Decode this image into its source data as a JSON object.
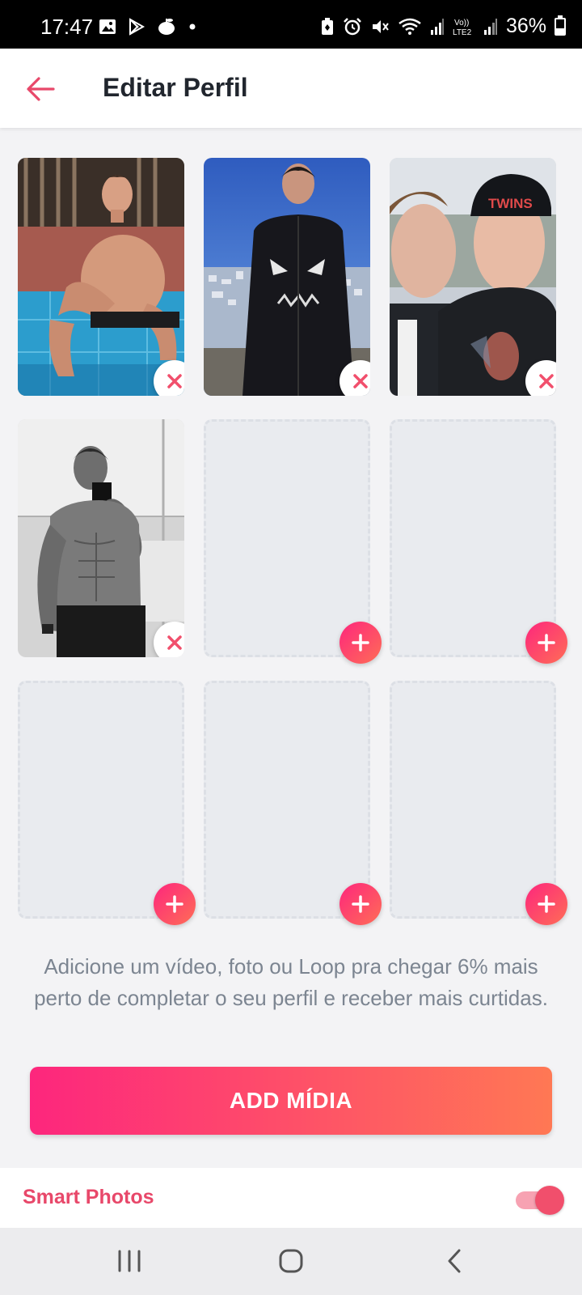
{
  "status_bar": {
    "time": "17:47",
    "battery": "36%",
    "battery_level": 0.36,
    "icons_left": [
      "gallery-icon",
      "play-store-icon",
      "apple-icon",
      "dot-icon"
    ],
    "icons_right": [
      "battery-saver-icon",
      "alarm-icon",
      "mute-icon",
      "wifi-icon",
      "signal-icon",
      "volte-icon",
      "signal-icon"
    ],
    "volte_label": "Vo))\nLTE2"
  },
  "header": {
    "back_icon": "arrow-left-icon",
    "title": "Editar Perfil",
    "accent": "#e8486a"
  },
  "media_grid": {
    "tiles": [
      {
        "state": "photo",
        "action": "remove"
      },
      {
        "state": "photo",
        "action": "remove"
      },
      {
        "state": "photo",
        "action": "remove"
      },
      {
        "state": "photo",
        "action": "remove"
      },
      {
        "state": "empty",
        "action": "add"
      },
      {
        "state": "empty",
        "action": "add"
      },
      {
        "state": "empty",
        "action": "add"
      },
      {
        "state": "empty",
        "action": "add"
      },
      {
        "state": "empty",
        "action": "add"
      }
    ],
    "photo_cap_text": "TWINS"
  },
  "hint_text": "Adicione um vídeo, foto ou Loop pra chegar 6% mais perto de completar o seu perfil e receber mais curtidas.",
  "add_media_label": "ADD MÍDIA",
  "smart_photos": {
    "label": "Smart Photos",
    "enabled": true
  },
  "nav_bar": {
    "items": [
      "recent-apps-icon",
      "home-icon",
      "back-icon"
    ]
  },
  "colors": {
    "brand_gradient_start": "#fd267d",
    "brand_gradient_end": "#ff7854",
    "title_text": "#21262e",
    "hint_text": "#7c8591"
  }
}
